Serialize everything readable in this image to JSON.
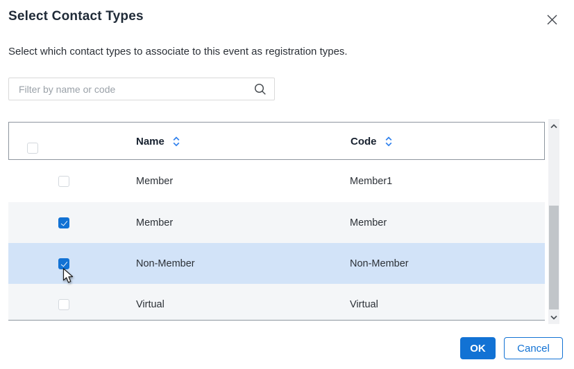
{
  "dialog": {
    "title": "Select Contact Types",
    "description": "Select which contact types to associate to this event as registration types."
  },
  "filter": {
    "placeholder": "Filter by name or code",
    "value": ""
  },
  "table": {
    "select_all_checked": false,
    "columns": [
      {
        "label": "Name",
        "sortable": true
      },
      {
        "label": "Code",
        "sortable": true
      }
    ],
    "rows": [
      {
        "name": "Member",
        "code": "Member1",
        "checked": false,
        "highlighted": false
      },
      {
        "name": "Member",
        "code": "Member",
        "checked": true,
        "highlighted": false
      },
      {
        "name": "Non-Member",
        "code": "Non-Member",
        "checked": true,
        "highlighted": true
      },
      {
        "name": "Virtual",
        "code": "Virtual",
        "checked": false,
        "highlighted": false
      }
    ]
  },
  "footer": {
    "ok_label": "OK",
    "cancel_label": "Cancel"
  },
  "colors": {
    "accent": "#1272d4",
    "row_highlight": "#d2e3f8",
    "zebra": "#f4f6f8",
    "header_border": "#8d959e",
    "title_text": "#1f2a37",
    "body_text": "#262c33",
    "sort_icon": "#2f80ed"
  }
}
